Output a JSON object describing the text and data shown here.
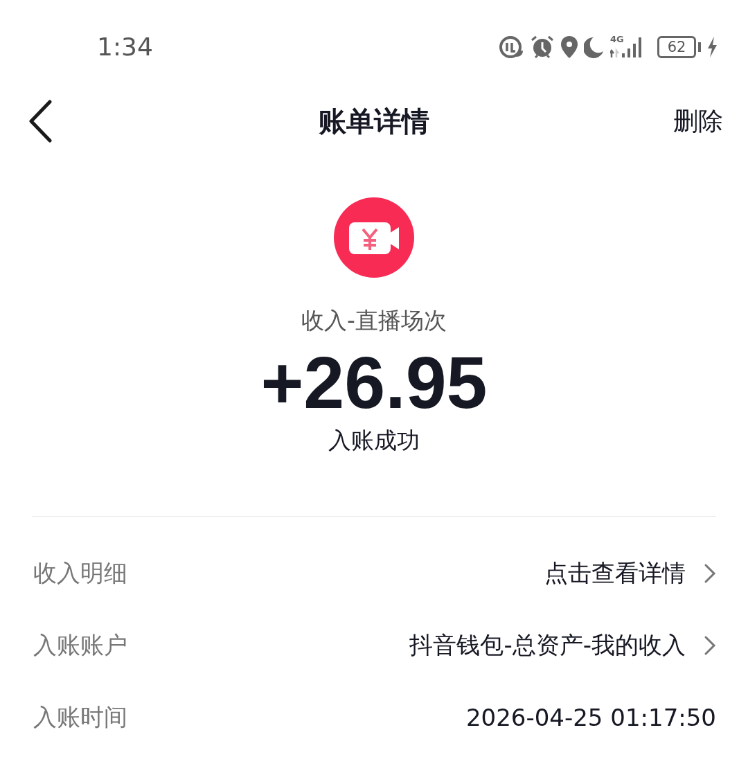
{
  "status_bar": {
    "time": "1:34",
    "network": "4G",
    "battery": "62",
    "charging": true
  },
  "header": {
    "title": "账单详情",
    "action": "删除"
  },
  "summary": {
    "category": "收入-直播场次",
    "amount": "+26.95",
    "status": "入账成功"
  },
  "rows": [
    {
      "label": "收入明细",
      "value": "点击查看详情",
      "kind": "link"
    },
    {
      "label": "入账账户",
      "value": "抖音钱包-总资产-我的收入",
      "kind": "link"
    },
    {
      "label": "入账时间",
      "value": "2026-04-25 01:17:50",
      "kind": "plain"
    }
  ]
}
